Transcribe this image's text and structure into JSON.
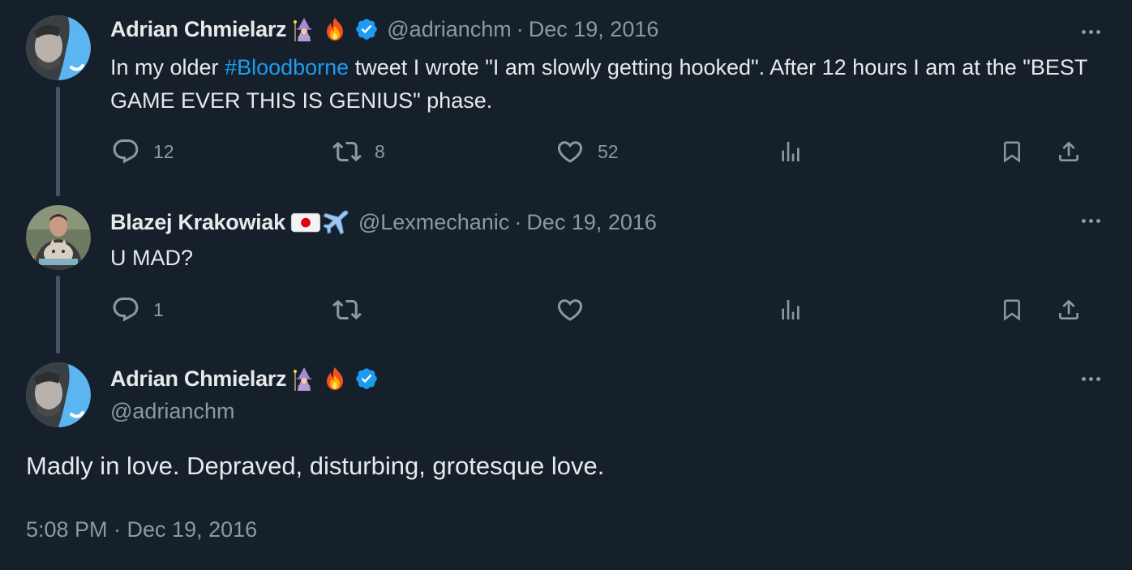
{
  "tweets": [
    {
      "author": "Adrian Chmielarz",
      "emojis": [
        "wizard-emoji",
        "fire-emoji"
      ],
      "verified": true,
      "handle": "@adrianchm",
      "separator": "·",
      "date": "Dec 19, 2016",
      "text_prefix": "In my older ",
      "hashtag": "#Bloodborne",
      "text_suffix": " tweet I wrote \"I am slowly getting hooked\". After 12 hours I am at the \"BEST GAME EVER THIS IS GENIUS\" phase.",
      "replies": "12",
      "retweets": "8",
      "likes": "52"
    },
    {
      "author": "Blazej Krakowiak",
      "emojis": [
        "japan-flag-emoji",
        "airplane-emoji"
      ],
      "verified": false,
      "handle": "@Lexmechanic",
      "separator": "·",
      "date": "Dec 19, 2016",
      "text": "U MAD?",
      "replies": "1",
      "retweets": "",
      "likes": ""
    }
  ],
  "focused": {
    "author": "Adrian Chmielarz",
    "emojis": [
      "wizard-emoji",
      "fire-emoji"
    ],
    "verified": true,
    "handle": "@adrianchm",
    "text": "Madly in love. Depraved, disturbing, grotesque love.",
    "timestamp": "5:08 PM · Dec 19, 2016"
  },
  "colors": {
    "background": "#15202b",
    "text_primary": "#e7e9ea",
    "text_secondary": "#8b98a5",
    "accent": "#1d9bf0",
    "thread_line": "#425466"
  },
  "icons": {
    "reply": "reply-icon",
    "retweet": "retweet-icon",
    "like": "heart-icon",
    "views": "views-icon",
    "bookmark": "bookmark-icon",
    "share": "share-icon",
    "more": "more-icon",
    "verified": "verified-badge-icon"
  }
}
